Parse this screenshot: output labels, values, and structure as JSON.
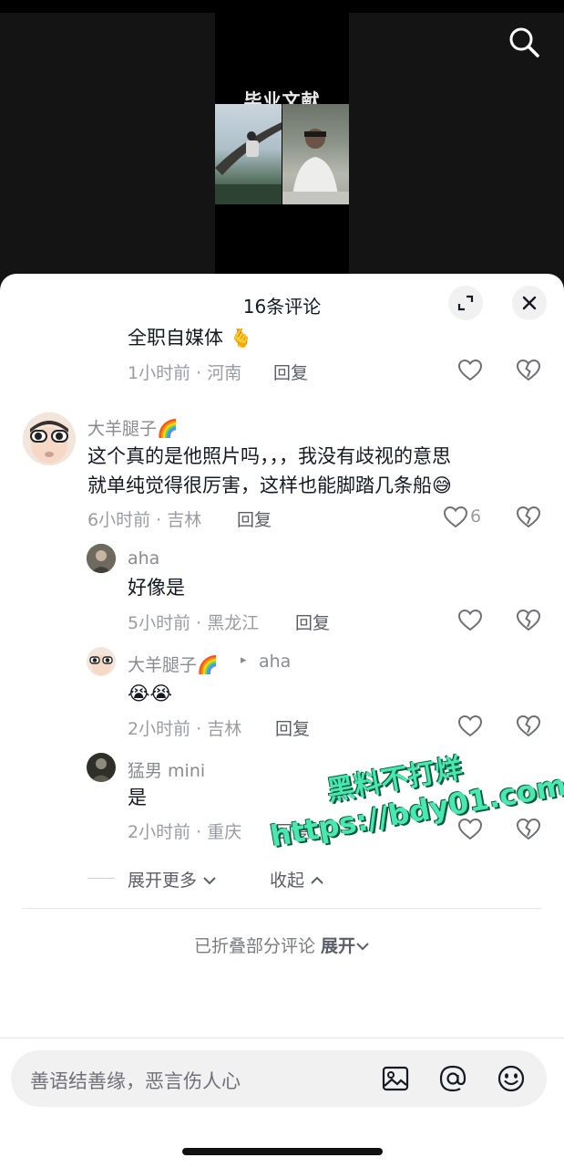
{
  "video": {
    "title": "毕业文献"
  },
  "comments_sheet": {
    "title": "16条评论",
    "partial_top": {
      "text": "全职自媒体 🫰",
      "time_location": "1小时前 · 河南",
      "reply": "回复"
    },
    "comments": [
      {
        "username": "大羊腿子🌈",
        "text_line1": "这个真的是他照片吗，，，我没有歧视的意思",
        "text_line2": "就单纯觉得很厉害，这样也能脚踏几条船😅",
        "time_location": "6小时前 · 吉林",
        "reply": "回复",
        "likes": "6"
      }
    ],
    "replies": [
      {
        "username": "aha",
        "text": "好像是",
        "time_location": "5小时前 · 黑龙江",
        "reply": "回复"
      },
      {
        "username": "大羊腿子🌈",
        "reply_to_arrow": "▸",
        "reply_to": "aha",
        "text": "😭😭",
        "time_location": "2小时前 · 吉林",
        "reply": "回复"
      },
      {
        "username": "猛男 mini",
        "text": "是",
        "time_location": "2小时前 · 重庆",
        "reply": "回复"
      }
    ],
    "expand_more": "展开更多",
    "collapse": "收起",
    "collapsed_note": "已折叠部分评论",
    "expand": "展开"
  },
  "input_bar": {
    "placeholder": "善语结善缘，恶言伤人心"
  },
  "watermark": {
    "line1": "黑料不打烊",
    "line2": "https://bdy01.com"
  },
  "colors": {
    "text_primary": "#161823",
    "text_secondary": "#9b9ca3",
    "watermark": "#49e8b0"
  }
}
